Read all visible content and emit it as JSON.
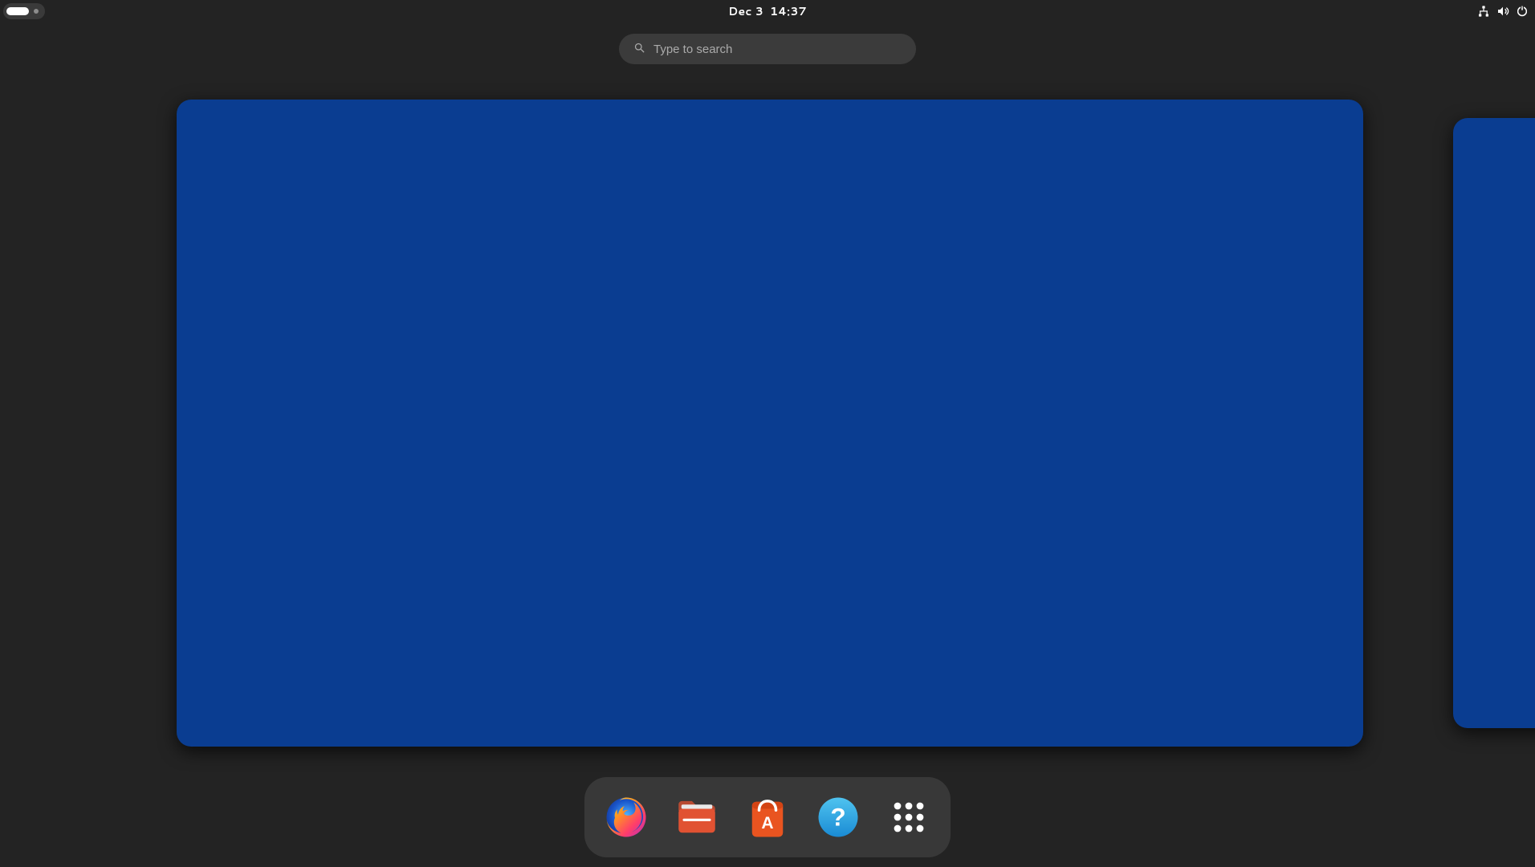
{
  "topbar": {
    "date": "Dec 3",
    "time": "14:37"
  },
  "search": {
    "placeholder": "Type to search",
    "value": ""
  },
  "status_icons": {
    "network": "network-wired-icon",
    "volume": "volume-icon",
    "power": "power-icon"
  },
  "workspaces": {
    "current": 1,
    "count": 2,
    "background_color": "#0a3d91"
  },
  "dock": {
    "items": [
      {
        "name": "firefox",
        "label": "Firefox Web Browser"
      },
      {
        "name": "files",
        "label": "Files"
      },
      {
        "name": "software",
        "label": "Ubuntu Software"
      },
      {
        "name": "help",
        "label": "Help"
      },
      {
        "name": "apps",
        "label": "Show Applications"
      }
    ]
  }
}
